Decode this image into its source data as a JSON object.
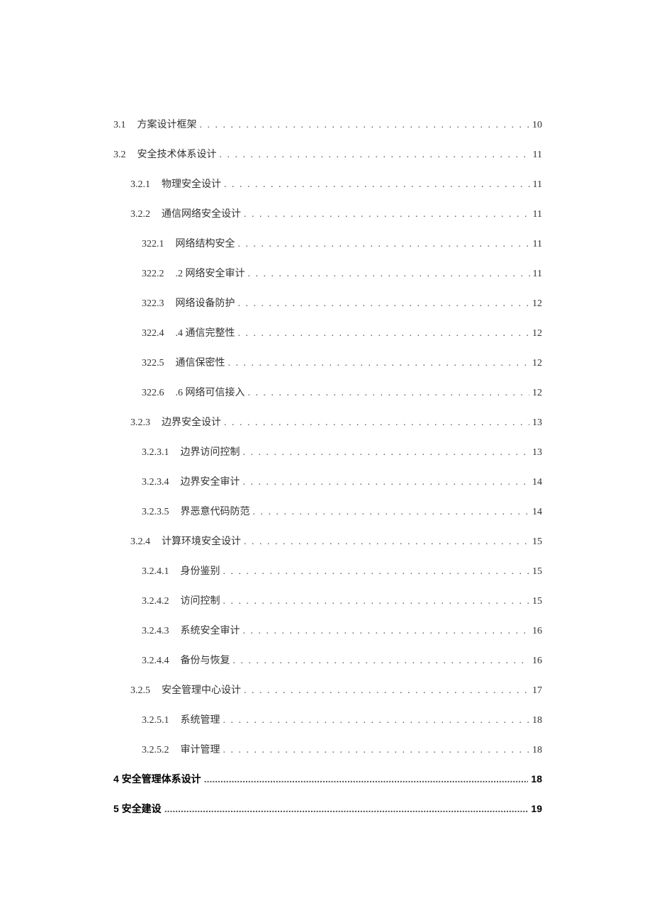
{
  "toc": [
    {
      "num": "3.1",
      "title": "方案设计框架",
      "page": "10",
      "indent": 0,
      "bold": false
    },
    {
      "num": "3.2",
      "title": "安全技术体系设计",
      "page": "11",
      "indent": 0,
      "bold": false
    },
    {
      "num": "3.2.1",
      "title": "物理安全设计",
      "page": "11",
      "indent": 1,
      "bold": false
    },
    {
      "num": "3.2.2",
      "title": "通信网络安全设计",
      "page": "11",
      "indent": 1,
      "bold": false
    },
    {
      "num": "322.1",
      "title": "网络结构安全",
      "page": "11",
      "indent": 2,
      "bold": false
    },
    {
      "num": "322.2",
      "title": ".2 网络安全审计",
      "page": "11",
      "indent": 2,
      "bold": false
    },
    {
      "num": "322.3",
      "title": "网络设备防护",
      "page": "12",
      "indent": 2,
      "bold": false
    },
    {
      "num": "322.4",
      "title": ".4 通信完整性",
      "page": "12",
      "indent": 2,
      "bold": false
    },
    {
      "num": "322.5",
      "title": "通信保密性",
      "page": "12",
      "indent": 2,
      "bold": false
    },
    {
      "num": "322.6",
      "title": ".6 网络可信接入",
      "page": "12",
      "indent": 2,
      "bold": false
    },
    {
      "num": "3.2.3",
      "title": "边界安全设计",
      "page": "13",
      "indent": 1,
      "bold": false
    },
    {
      "num": "3.2.3.1",
      "title": "边界访问控制",
      "page": "13",
      "indent": 2,
      "bold": false
    },
    {
      "num": "3.2.3.4",
      "title": "边界安全审计",
      "page": "14",
      "indent": 2,
      "bold": false
    },
    {
      "num": "3.2.3.5",
      "title": "界恶意代码防范",
      "page": "14",
      "indent": 2,
      "bold": false
    },
    {
      "num": "3.2.4",
      "title": "计算环境安全设计",
      "page": "15",
      "indent": 1,
      "bold": false
    },
    {
      "num": "3.2.4.1",
      "title": "身份鉴别",
      "page": "15",
      "indent": 2,
      "bold": false
    },
    {
      "num": "3.2.4.2",
      "title": "访问控制",
      "page": "15",
      "indent": 2,
      "bold": false
    },
    {
      "num": "3.2.4.3",
      "title": "系统安全审计",
      "page": "16",
      "indent": 2,
      "bold": false
    },
    {
      "num": "3.2.4.4",
      "title": "备份与恢复",
      "page": "16",
      "indent": 2,
      "bold": false
    },
    {
      "num": "3.2.5",
      "title": "安全管理中心设计",
      "page": "17",
      "indent": 1,
      "bold": false
    },
    {
      "num": "3.2.5.1",
      "title": "系统管理",
      "page": "18",
      "indent": 2,
      "bold": false
    },
    {
      "num": "3.2.5.2",
      "title": "审计管理",
      "page": "18",
      "indent": 2,
      "bold": false
    },
    {
      "num": "4",
      "title": "安全管理体系设计",
      "page": "18",
      "indent": 0,
      "bold": true
    },
    {
      "num": "5",
      "title": "安全建设",
      "page": "19",
      "indent": 0,
      "bold": true
    }
  ]
}
